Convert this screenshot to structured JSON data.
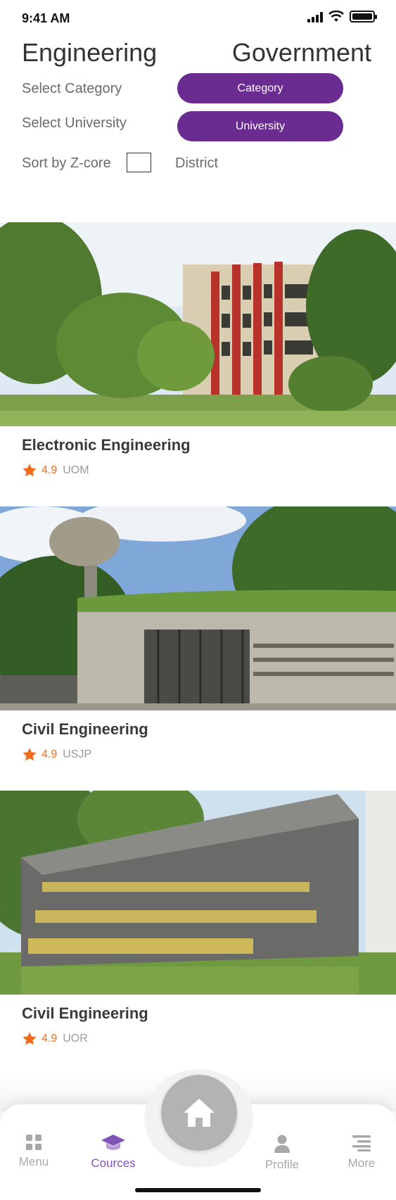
{
  "status_bar": {
    "time": "9:41 AM",
    "icons": [
      "signal-icon",
      "wifi-icon",
      "battery-icon"
    ]
  },
  "header": {
    "title_left": "Engineering",
    "title_right": "Government"
  },
  "filters": {
    "category_label": "Select Category",
    "category_button": "Category",
    "university_label": "Select University",
    "university_button": "University",
    "sort_label": "Sort by Z-core",
    "sort_checked": false,
    "district_label": "District"
  },
  "courses": [
    {
      "title": "Electronic Engineering",
      "rating": "4.9",
      "university": "UOM",
      "image": "campus-building-photo"
    },
    {
      "title": "Civil Engineering",
      "rating": "4.9",
      "university": "USJP",
      "image": "university-gate-photo"
    },
    {
      "title": "Civil Engineering",
      "rating": "4.9",
      "university": "UOR",
      "image": "university-sign-photo"
    }
  ],
  "tabbar": {
    "items": [
      {
        "label": "Menu",
        "icon": "grid-icon"
      },
      {
        "label": "Cources",
        "icon": "graduation-cap-icon"
      },
      {
        "label": "Profile",
        "icon": "user-icon"
      },
      {
        "label": "More",
        "icon": "list-icon"
      }
    ],
    "home_icon": "home-icon"
  },
  "colors": {
    "accent": "#6b2c91",
    "active_tab": "#7f56b8",
    "rating": "#f06a1a",
    "inactive": "#a8a8a8"
  }
}
